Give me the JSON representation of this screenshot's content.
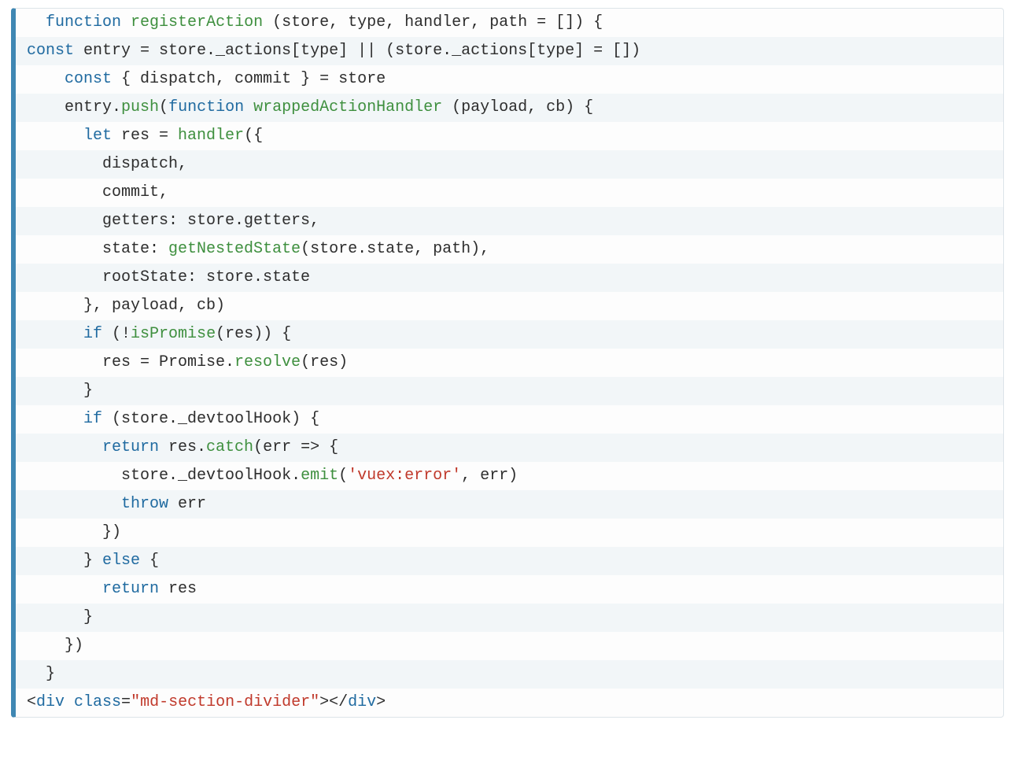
{
  "code": {
    "lines": [
      {
        "indent": 1,
        "tokens": [
          {
            "t": "function ",
            "c": "kw"
          },
          {
            "t": "registerAction ",
            "c": "fn"
          },
          {
            "t": "(store, type, handler, path = []) {"
          }
        ]
      },
      {
        "indent": 0,
        "tokens": [
          {
            "t": "const ",
            "c": "kw"
          },
          {
            "t": "entry = store._actions[type] || (store._actions[type] = [])"
          }
        ]
      },
      {
        "indent": 2,
        "tokens": [
          {
            "t": "const ",
            "c": "kw"
          },
          {
            "t": "{ dispatch, commit } = store"
          }
        ]
      },
      {
        "indent": 2,
        "tokens": [
          {
            "t": "entry."
          },
          {
            "t": "push",
            "c": "fn"
          },
          {
            "t": "("
          },
          {
            "t": "function ",
            "c": "kw"
          },
          {
            "t": "wrappedActionHandler ",
            "c": "fn"
          },
          {
            "t": "(payload, cb) {"
          }
        ]
      },
      {
        "indent": 3,
        "tokens": [
          {
            "t": "let ",
            "c": "kw"
          },
          {
            "t": "res = "
          },
          {
            "t": "handler",
            "c": "fn"
          },
          {
            "t": "({"
          }
        ]
      },
      {
        "indent": 4,
        "tokens": [
          {
            "t": "dispatch,"
          }
        ]
      },
      {
        "indent": 4,
        "tokens": [
          {
            "t": "commit,"
          }
        ]
      },
      {
        "indent": 4,
        "tokens": [
          {
            "t": "getters: store.getters,"
          }
        ]
      },
      {
        "indent": 4,
        "tokens": [
          {
            "t": "state: "
          },
          {
            "t": "getNestedState",
            "c": "fn"
          },
          {
            "t": "(store.state, path),"
          }
        ]
      },
      {
        "indent": 4,
        "tokens": [
          {
            "t": "rootState: store.state"
          }
        ]
      },
      {
        "indent": 3,
        "tokens": [
          {
            "t": "}, payload, cb)"
          }
        ]
      },
      {
        "indent": 3,
        "tokens": [
          {
            "t": "if ",
            "c": "kw"
          },
          {
            "t": "(!"
          },
          {
            "t": "isPromise",
            "c": "fn"
          },
          {
            "t": "(res)) {"
          }
        ]
      },
      {
        "indent": 4,
        "tokens": [
          {
            "t": "res = Promise."
          },
          {
            "t": "resolve",
            "c": "fn"
          },
          {
            "t": "(res)"
          }
        ]
      },
      {
        "indent": 3,
        "tokens": [
          {
            "t": "}"
          }
        ]
      },
      {
        "indent": 3,
        "tokens": [
          {
            "t": "if ",
            "c": "kw"
          },
          {
            "t": "(store._devtoolHook) {"
          }
        ]
      },
      {
        "indent": 4,
        "tokens": [
          {
            "t": "return ",
            "c": "kw"
          },
          {
            "t": "res."
          },
          {
            "t": "catch",
            "c": "fn"
          },
          {
            "t": "(err => {"
          }
        ]
      },
      {
        "indent": 5,
        "tokens": [
          {
            "t": "store._devtoolHook."
          },
          {
            "t": "emit",
            "c": "fn"
          },
          {
            "t": "("
          },
          {
            "t": "'vuex:error'",
            "c": "str"
          },
          {
            "t": ", err)"
          }
        ]
      },
      {
        "indent": 5,
        "tokens": [
          {
            "t": "throw ",
            "c": "kw"
          },
          {
            "t": "err"
          }
        ]
      },
      {
        "indent": 4,
        "tokens": [
          {
            "t": "})"
          }
        ]
      },
      {
        "indent": 3,
        "tokens": [
          {
            "t": "} "
          },
          {
            "t": "else ",
            "c": "kw"
          },
          {
            "t": "{"
          }
        ]
      },
      {
        "indent": 4,
        "tokens": [
          {
            "t": "return ",
            "c": "kw"
          },
          {
            "t": "res"
          }
        ]
      },
      {
        "indent": 3,
        "tokens": [
          {
            "t": "}"
          }
        ]
      },
      {
        "indent": 2,
        "tokens": [
          {
            "t": "})"
          }
        ]
      },
      {
        "indent": 1,
        "tokens": [
          {
            "t": "}"
          }
        ]
      },
      {
        "indent": 0,
        "tokens": [
          {
            "t": "<"
          },
          {
            "t": "div ",
            "c": "tag"
          },
          {
            "t": "class",
            "c": "attr"
          },
          {
            "t": "="
          },
          {
            "t": "\"md-section-divider\"",
            "c": "str"
          },
          {
            "t": ">"
          },
          {
            "t": "</"
          },
          {
            "t": "div",
            "c": "tag"
          },
          {
            "t": ">"
          }
        ]
      }
    ],
    "indent_unit": "  "
  }
}
